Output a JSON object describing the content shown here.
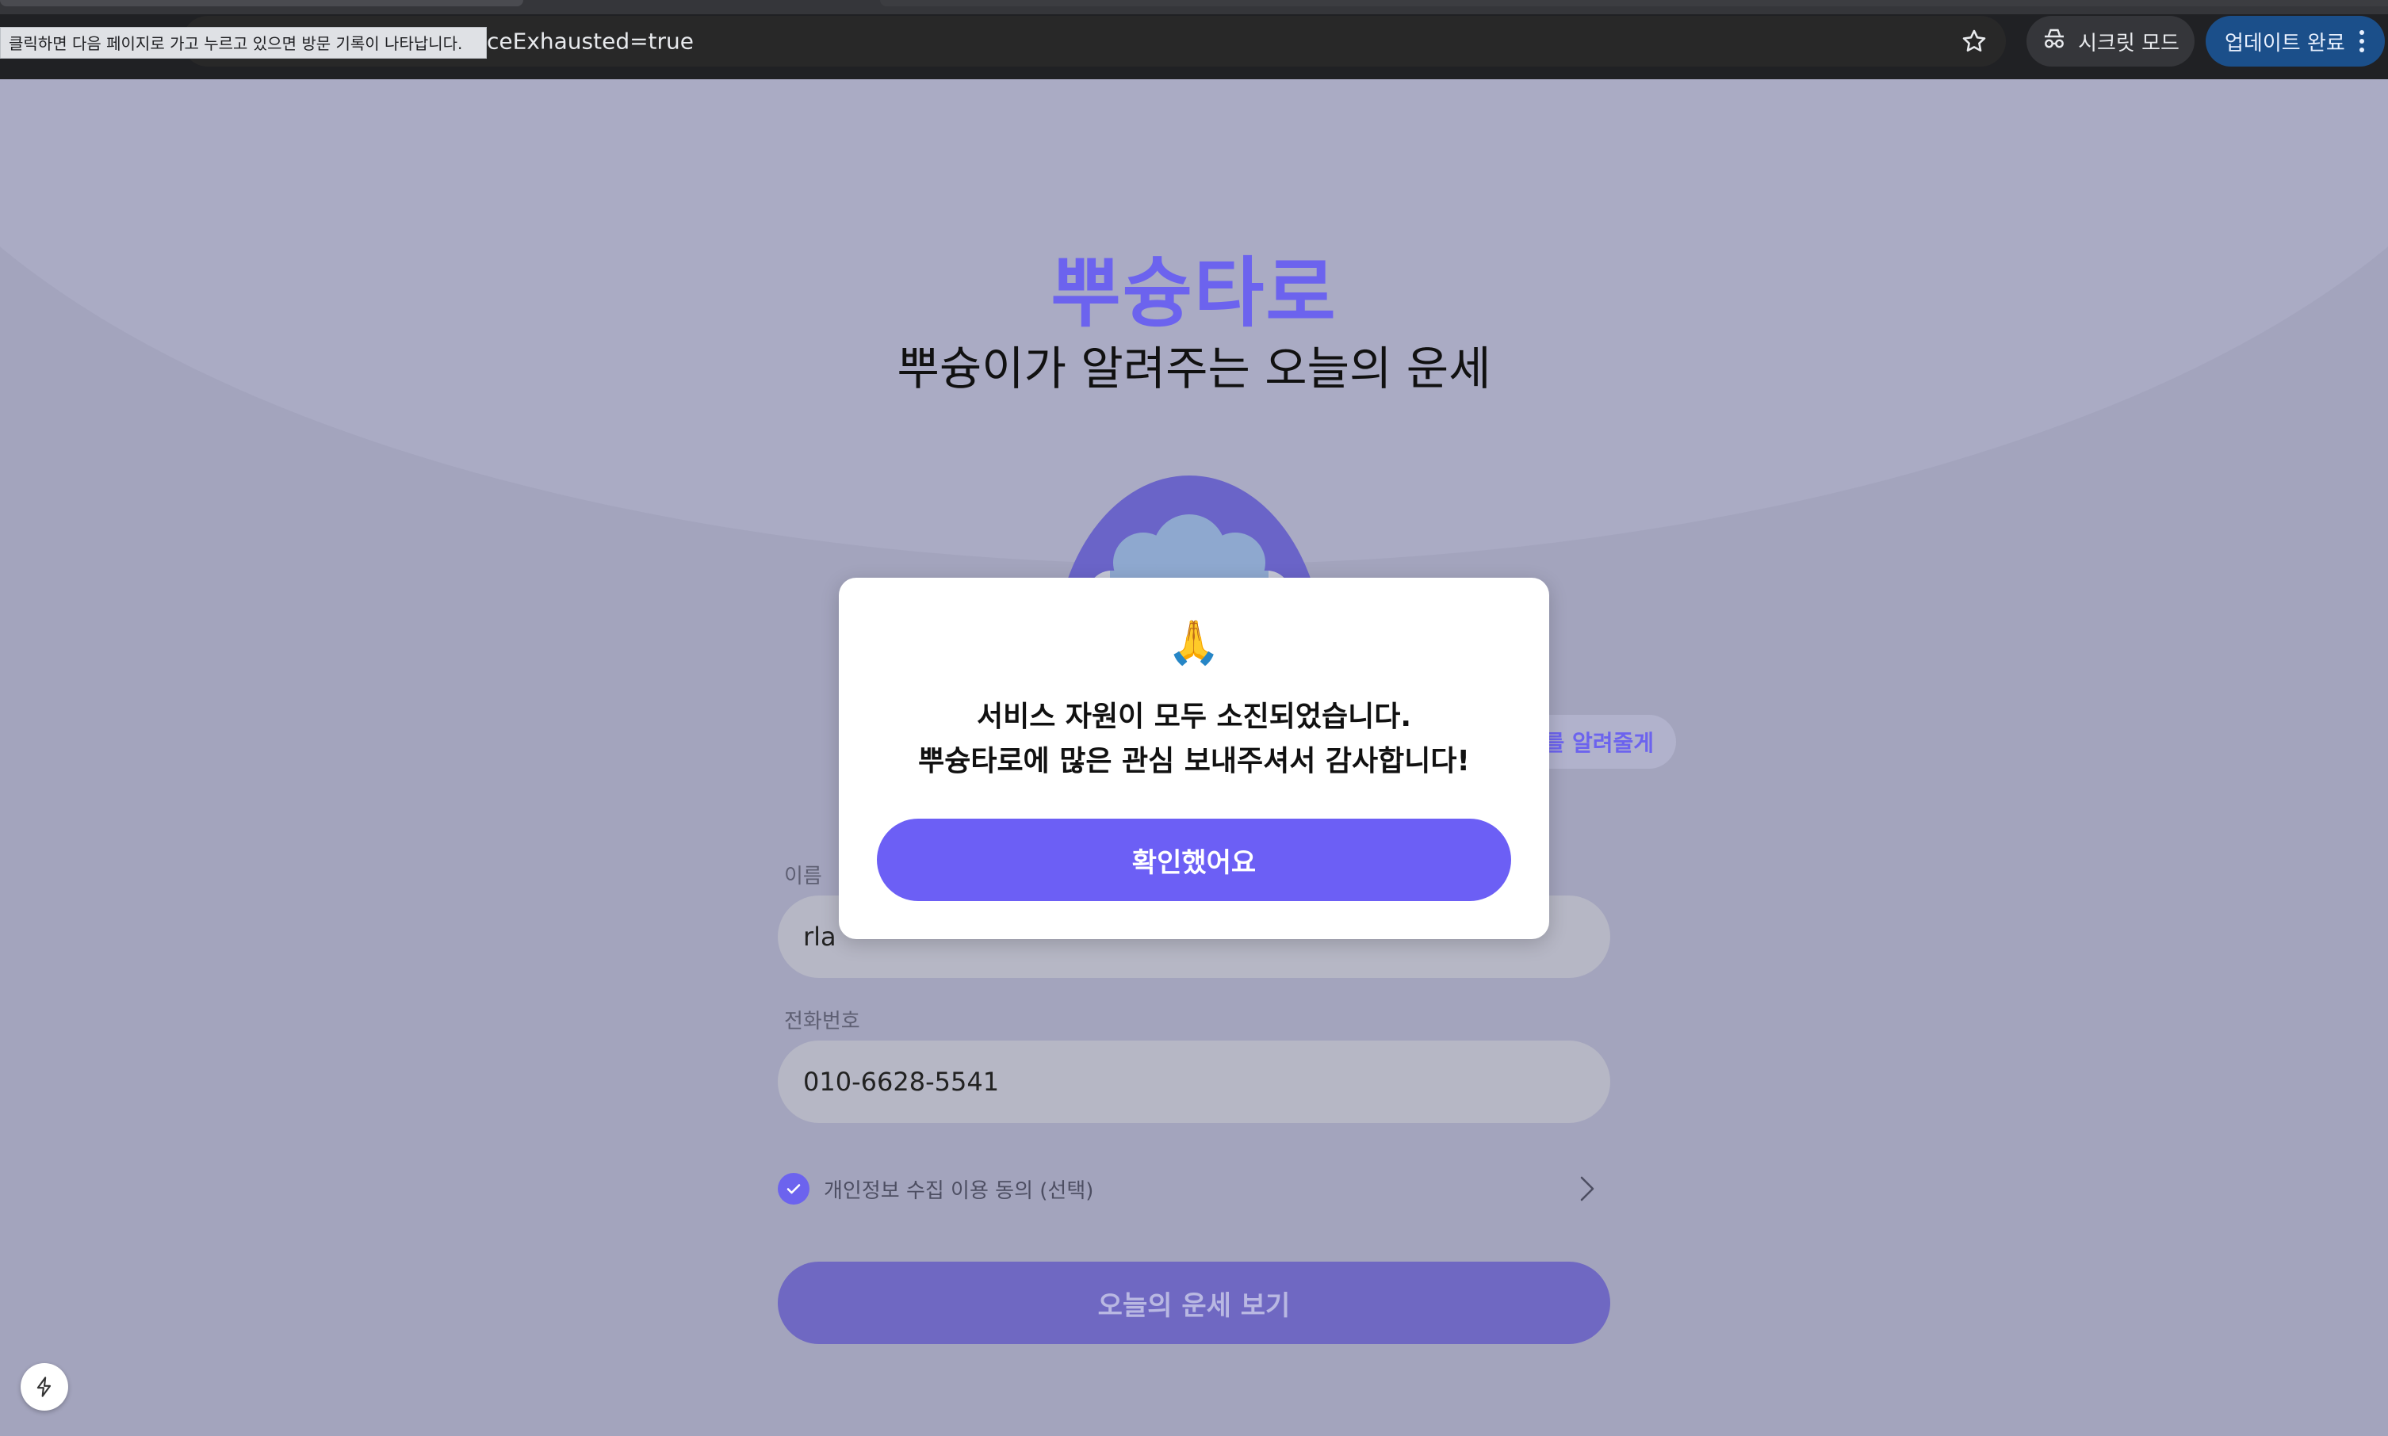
{
  "browser": {
    "url_fragment": "ceExhausted=true",
    "status_tooltip": "클릭하면 다음 페이지로 가고 누르고 있으면 방문 기록이 나타납니다.",
    "incognito_label": "시크릿 모드",
    "update_label": "업데이트 완료",
    "icons": {
      "bookmark": "star-icon",
      "incognito": "incognito-icon",
      "menu": "kebab-menu-icon"
    }
  },
  "page": {
    "title": "뿌슝타로",
    "subtitle": "뿌슝이가 알려주는 오늘의 운세",
    "tag_pill_text": "를 알려줄게",
    "form": {
      "name_label": "이름",
      "name_value": "rla",
      "phone_label": "전화번호",
      "phone_value": "010-6628-5541",
      "consent_label": "개인정보 수집 이용 동의 (선택)",
      "consent_checked": true,
      "submit_label": "오늘의 운세 보기"
    },
    "colors": {
      "brand": "#6c63ee",
      "modal_button": "#6c5ff5",
      "overlay_page": "#a3a4bd"
    }
  },
  "modal": {
    "emoji": "🙏",
    "message_line1": "서비스 자원이 모두 소진되었습니다.",
    "message_line2": "뿌슝타로에 많은 관심 보내주셔서 감사합니다!",
    "confirm_label": "확인했어요"
  }
}
